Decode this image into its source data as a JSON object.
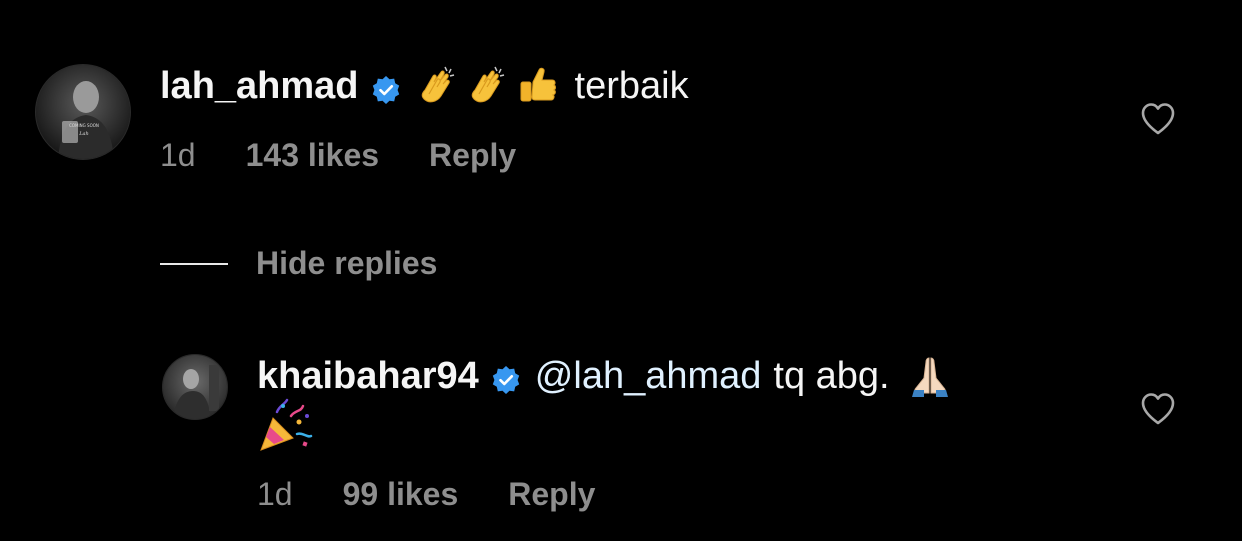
{
  "comment": {
    "username": "lah_ahmad",
    "verified": true,
    "emojis": [
      "clapping-hands",
      "clapping-hands",
      "thumbs-up"
    ],
    "text": "terbaik",
    "time": "1d",
    "likes": "143 likes",
    "reply_label": "Reply"
  },
  "hide_replies_label": "Hide replies",
  "reply": {
    "username": "khaibahar94",
    "verified": true,
    "mention": "@lah_ahmad",
    "text": "tq abg.",
    "emojis": [
      "folded-hands",
      "party-popper"
    ],
    "time": "1d",
    "likes": "99 likes",
    "reply_label": "Reply"
  },
  "colors": {
    "background": "#000000",
    "primary_text": "#f5f5f5",
    "secondary_text": "#8e8e8e",
    "verified_badge": "#3797f0",
    "mention": "#e0f1ff"
  }
}
